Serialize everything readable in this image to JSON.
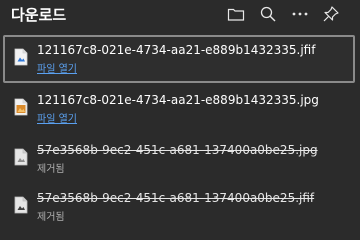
{
  "header": {
    "title": "다운로드",
    "icons": [
      "folder-icon",
      "search-icon",
      "more-icon",
      "pin-icon"
    ]
  },
  "downloads": [
    {
      "filename": "121167c8-021e-4734-aa21-e889b1432335.jfif",
      "action": "파일 열기",
      "type": "image",
      "removed": false,
      "selected": true
    },
    {
      "filename": "121167c8-021e-4734-aa21-e889b1432335.jpg",
      "action": "파일 열기",
      "type": "image",
      "removed": false,
      "selected": false
    },
    {
      "filename": "57e3568b-9ec2-451c-a681-137400a0be25.jpg",
      "action": "제거됨",
      "type": "image",
      "removed": true,
      "selected": false
    },
    {
      "filename": "57e3568b-9ec2-451c-a681-137400a0be25.jfif",
      "action": "제거됨",
      "type": "image",
      "removed": true,
      "selected": false
    }
  ],
  "colors": {
    "background": "#2b2b2b",
    "link": "#5aa0f0",
    "selected_border": "#8a8a8a"
  }
}
